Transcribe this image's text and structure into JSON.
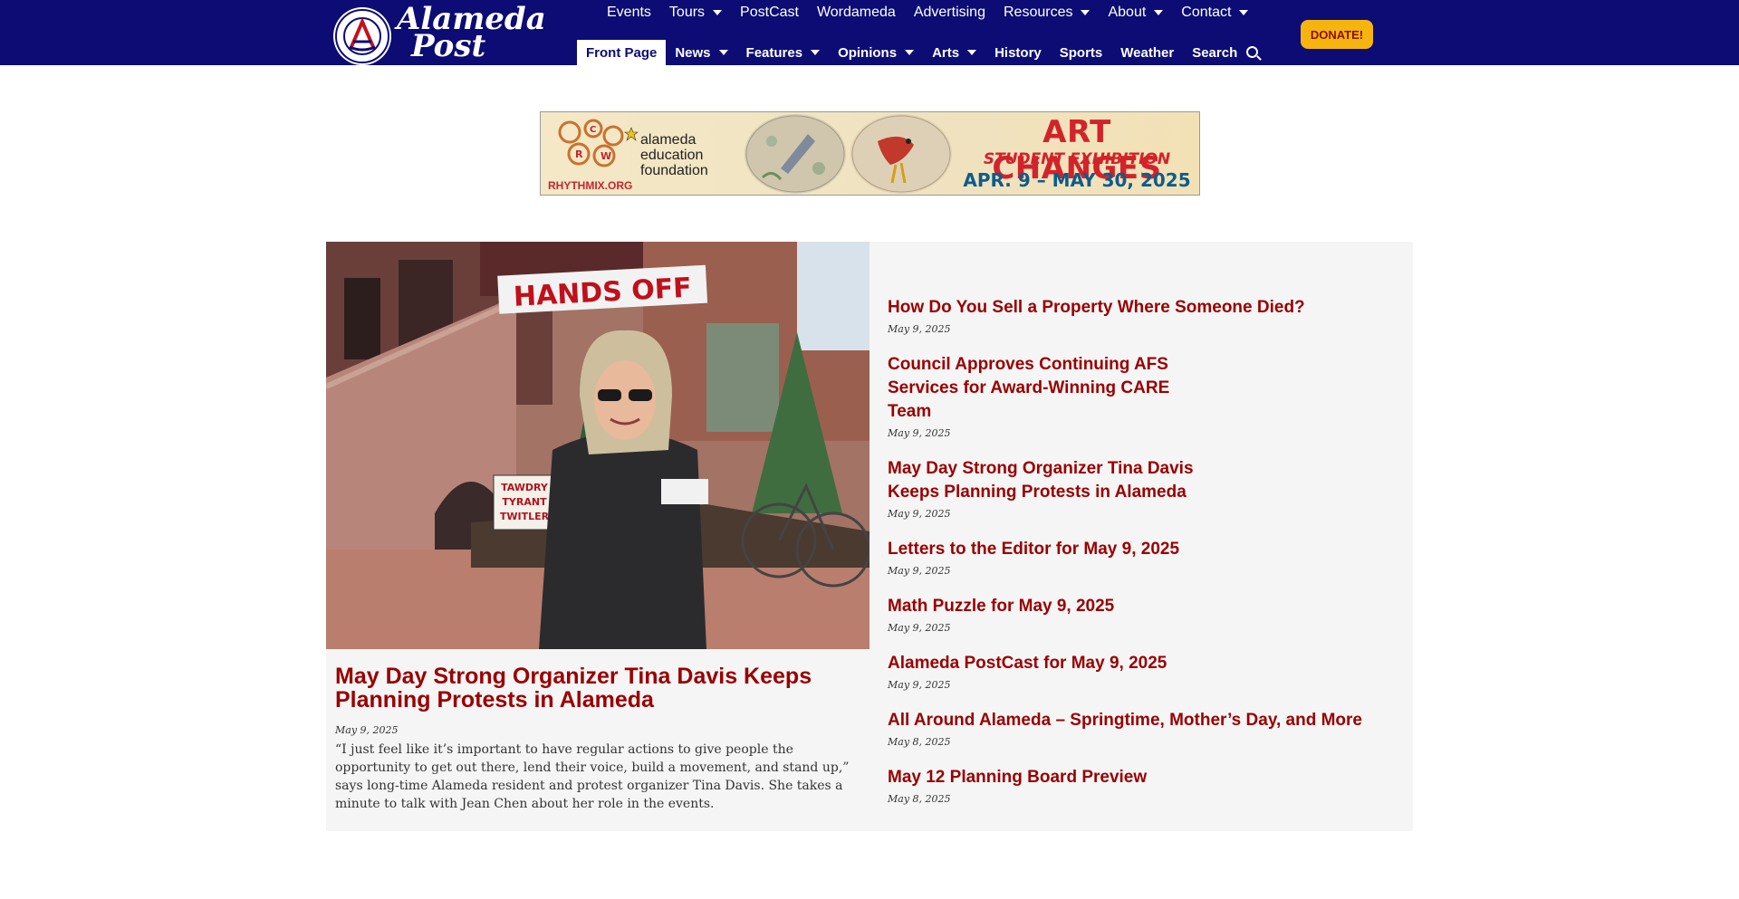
{
  "site": {
    "logo_line1": "Alameda",
    "logo_line2": "Post",
    "logo_mark": "A"
  },
  "top_nav": [
    {
      "label": "Events",
      "has_dropdown": false
    },
    {
      "label": "Tours",
      "has_dropdown": true
    },
    {
      "label": "PostCast",
      "has_dropdown": false
    },
    {
      "label": "Wordameda",
      "has_dropdown": false
    },
    {
      "label": "Advertising",
      "has_dropdown": false
    },
    {
      "label": "Resources",
      "has_dropdown": true
    },
    {
      "label": "About",
      "has_dropdown": true
    },
    {
      "label": "Contact",
      "has_dropdown": true
    }
  ],
  "main_nav": [
    {
      "label": "Front Page",
      "active": true,
      "has_dropdown": false
    },
    {
      "label": "News",
      "active": false,
      "has_dropdown": true
    },
    {
      "label": "Features",
      "active": false,
      "has_dropdown": true
    },
    {
      "label": "Opinions",
      "active": false,
      "has_dropdown": true
    },
    {
      "label": "Arts",
      "active": false,
      "has_dropdown": true
    },
    {
      "label": "History",
      "active": false,
      "has_dropdown": false
    },
    {
      "label": "Sports",
      "active": false,
      "has_dropdown": false
    },
    {
      "label": "Weather",
      "active": false,
      "has_dropdown": false
    },
    {
      "label": "Search",
      "active": false,
      "has_dropdown": false
    }
  ],
  "donate_label": "DONATE!",
  "banner": {
    "rhythmix": "RHYTHMIX.ORG",
    "gear_letters": [
      "R",
      "C",
      "W"
    ],
    "aef_line1": "alameda",
    "aef_line2": "education",
    "aef_line3": "foundation",
    "title": "ART CHANGES",
    "subtitle": "STUDENT EXHIBITION",
    "dates": "APR. 9 – MAY 30, 2025"
  },
  "featured": {
    "image_signs": [
      "HANDS OFF",
      "TAWDRY",
      "TYRANT",
      "TWITLER"
    ],
    "title": "May Day Strong Organizer Tina Davis Keeps Planning Protests in Alameda",
    "date": "May 9, 2025",
    "excerpt": "“I just feel like it’s important to have regular actions to give people the opportunity to get out there, lend their voice, build a movement, and stand up,” says long-time Alameda resident and protest organizer Tina Davis. She takes a minute to talk with Jean Chen about her role in the events."
  },
  "articles": [
    {
      "title": "How Do You Sell a Property Where Someone Died?",
      "date": "May 9, 2025"
    },
    {
      "title": "Council Approves Continuing AFS Services for Award-Winning CARE Team",
      "date": "May 9, 2025"
    },
    {
      "title": "May Day Strong Organizer Tina Davis Keeps Planning Protests in Alameda",
      "date": "May 9, 2025"
    },
    {
      "title": "Letters to the Editor for May 9, 2025",
      "date": "May 9, 2025"
    },
    {
      "title": "Math Puzzle for May 9, 2025",
      "date": "May 9, 2025"
    },
    {
      "title": "Alameda PostCast for May 9, 2025",
      "date": "May 9, 2025"
    },
    {
      "title": "All Around Alameda – Springtime, Mother’s Day, and More",
      "date": "May 8, 2025"
    },
    {
      "title": "May 12 Planning Board Preview",
      "date": "May 8, 2025"
    }
  ],
  "colors": {
    "header_bg": "#0c0c74",
    "headline": "#990000",
    "donate_bg": "#f6b40e",
    "content_bg": "#f5f5f5"
  }
}
